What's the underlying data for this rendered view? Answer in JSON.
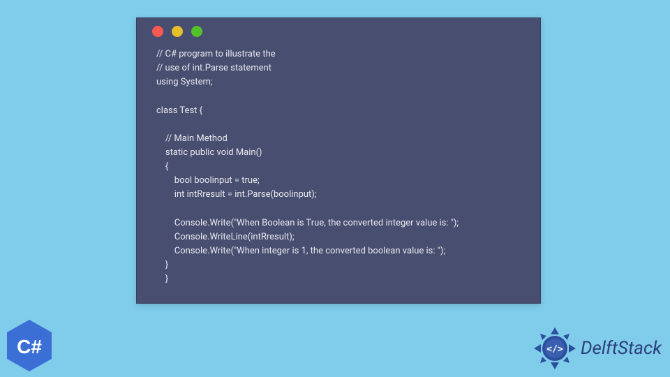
{
  "code": {
    "lines": [
      "// C# program to illustrate the",
      "// use of int.Parse statement",
      "using System;",
      "",
      "class Test {",
      "",
      "    // Main Method",
      "    static public void Main()",
      "    {",
      "        bool boolinput = true;",
      "        int intRresult = int.Parse(boolinput);",
      "",
      "        Console.Write(\"When Boolean is True, the converted integer value is: \");",
      "        Console.WriteLine(intRresult);",
      "        Console.Write(\"When integer is 1, the converted boolean value is: \");",
      "    }",
      "    }"
    ]
  },
  "logos": {
    "csharp_label": "C#",
    "delft_text": "DelftStack"
  },
  "colors": {
    "page_bg": "#7fcdea",
    "window_bg": "#474e70",
    "code_text": "#e8e9ef",
    "dot_red": "#ff5a52",
    "dot_yellow": "#e6c029",
    "dot_green": "#54c22b",
    "csharp_hex": "#3b6fd6",
    "delft_accent": "#2c4f9e"
  }
}
